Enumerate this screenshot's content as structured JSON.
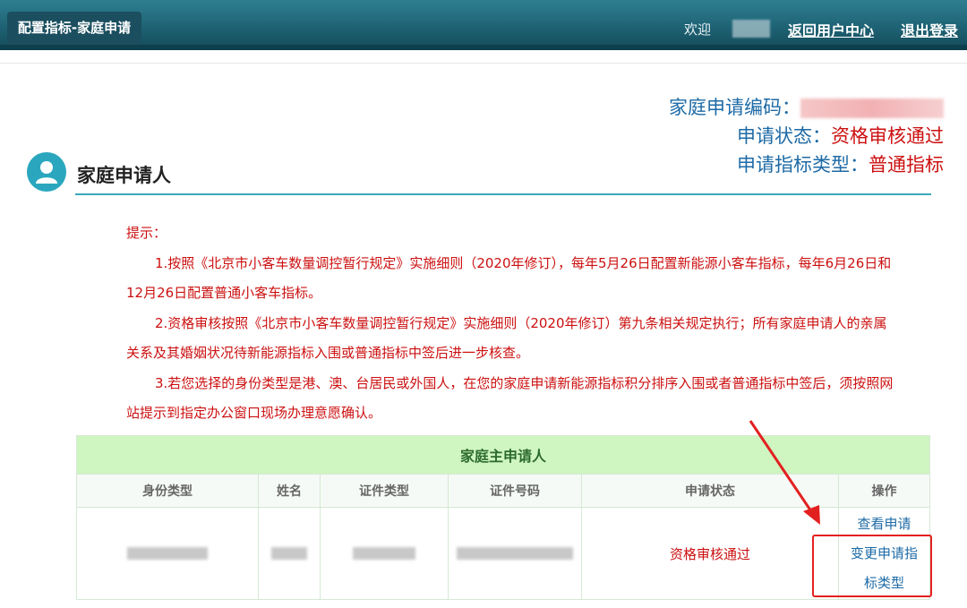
{
  "header": {
    "page_tab": "配置指标-家庭申请",
    "welcome": "欢迎",
    "return_link": "返回用户中心",
    "logout_link": "退出登录"
  },
  "application_info": {
    "code_label": "家庭申请编码：",
    "status_label": "申请状态：",
    "status_value": "资格审核通过",
    "type_label": "申请指标类型：",
    "type_value": "普通指标"
  },
  "section": {
    "title": "家庭申请人"
  },
  "tips": {
    "heading": "提示：",
    "items": [
      "1.按照《北京市小客车数量调控暂行规定》实施细则（2020年修订），每年5月26日配置新能源小客车指标，每年6月26日和12月26日配置普通小客车指标。",
      "2.资格审核按照《北京市小客车数量调控暂行规定》实施细则（2020年修订）第九条相关规定执行；所有家庭申请人的亲属关系及其婚姻状况待新能源指标入围或普通指标中签后进一步核查。",
      "3.若您选择的身份类型是港、澳、台居民或外国人，在您的家庭申请新能源指标积分排序入围或者普通指标中签后，须按照网站提示到指定办公窗口现场办理意愿确认。"
    ]
  },
  "table": {
    "caption": "家庭主申请人",
    "columns": [
      "身份类型",
      "姓名",
      "证件类型",
      "证件号码",
      "申请状态",
      "操作"
    ],
    "row": {
      "status": "资格审核通过",
      "actions": {
        "view": "查看申请",
        "change": "变更申请指标类型"
      }
    }
  },
  "colors": {
    "header_bg": "#1e6274",
    "accent_blue": "#1d6aa6",
    "alert_red": "#cc1010",
    "table_caption_bg": "#cff5c1",
    "highlight_red": "#e32020"
  }
}
